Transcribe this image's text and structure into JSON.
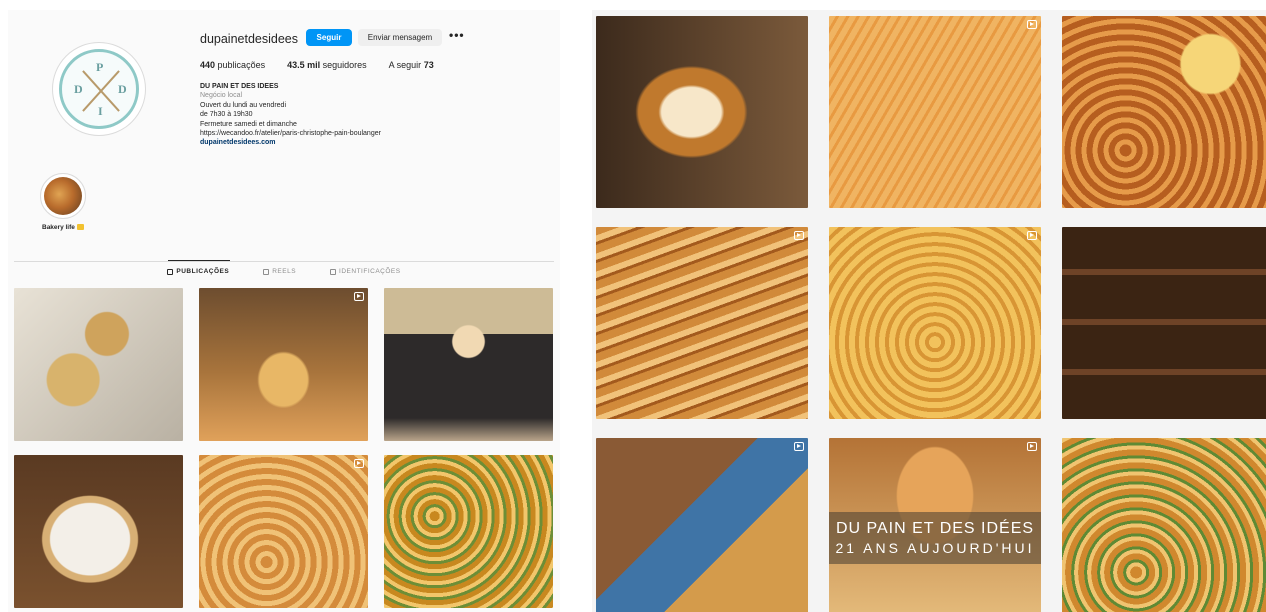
{
  "profile": {
    "username": "dupainetdesidees",
    "follow_label": "Seguir",
    "message_label": "Enviar mensagem",
    "more_label": "•••",
    "logo_letters": [
      "D",
      "P",
      "I",
      "D"
    ],
    "stats": {
      "posts_value": "440",
      "posts_label": "publicações",
      "followers_value": "43.5 mil",
      "followers_label": "seguidores",
      "following_label": "A seguir",
      "following_value": "73"
    },
    "bio": {
      "name": "DU PAIN ET DES IDEES",
      "category": "Negócio local",
      "line1": "Ouvert du lundi au vendredi",
      "line2": "de 7h30 à 19h30",
      "line3": "Fermeture samedi et dimanche",
      "line4": "https://wecandoo.fr/atelier/paris-christophe-pain-boulanger",
      "website": "dupainetdesidees.com"
    },
    "highlight_label": "Bakery life"
  },
  "tabs": [
    {
      "label": "PUBLICAÇÕES",
      "active": true
    },
    {
      "label": "REELS",
      "active": false
    },
    {
      "label": "IDENTIFICAÇÕES",
      "active": false
    }
  ],
  "left_posts": [
    {
      "type": "photo",
      "subject": "pastries on linen"
    },
    {
      "type": "reel",
      "subject": "bakery counter"
    },
    {
      "type": "photo",
      "subject": "woman with pastry"
    },
    {
      "type": "photo",
      "subject": "pastries on plate"
    },
    {
      "type": "reel",
      "subject": "escargots tray"
    },
    {
      "type": "photo",
      "subject": "pistachio escargots"
    }
  ],
  "right_posts": [
    {
      "type": "photo",
      "subject": "croissant cross-section"
    },
    {
      "type": "reel",
      "subject": "tarts tray"
    },
    {
      "type": "photo",
      "subject": "viennoiseries"
    },
    {
      "type": "reel",
      "subject": "pains au chocolat"
    },
    {
      "type": "reel",
      "subject": "fruit tarts"
    },
    {
      "type": "photo",
      "subject": "bread loaves"
    },
    {
      "type": "reel",
      "subject": "pastry display"
    },
    {
      "type": "photo",
      "subject": "anniversary post"
    },
    {
      "type": "photo",
      "subject": "escargots"
    }
  ],
  "overlay": {
    "line1": "DU PAIN ET DES IDÉES",
    "line2": "21 ANS AUJOURD'HUI"
  },
  "colors": {
    "accent": "#0095f6",
    "link": "#00376b",
    "logo_ring": "#8ec9c7"
  }
}
